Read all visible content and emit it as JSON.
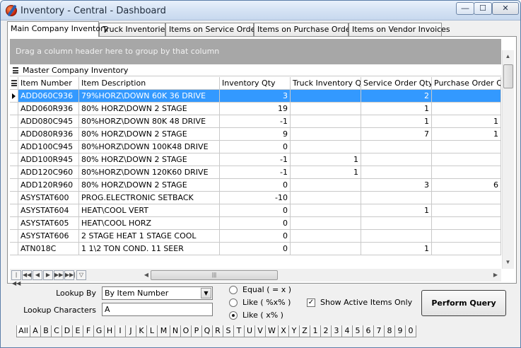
{
  "window": {
    "title": "Inventory - Central - Dashboard",
    "min_label": "—",
    "max_label": "☐",
    "close_label": "✕"
  },
  "tabs": [
    {
      "label": "Main Company Inventory",
      "active": true
    },
    {
      "label": "Truck Inventories",
      "active": false
    },
    {
      "label": "Items on Service Orders",
      "active": false
    },
    {
      "label": "Items on Purchase Orders",
      "active": false
    },
    {
      "label": "Items on Vendor Invoices",
      "active": false
    }
  ],
  "grid": {
    "group_hint": "Drag a column header here to group by that column",
    "band_title": "Master Company Inventory",
    "columns": [
      "Item Number",
      "Item Description",
      "Inventory Qty",
      "Truck Inventory Qty",
      "Service Order Qty",
      "Purchase Order Qty"
    ],
    "rows": [
      [
        "ADD060C936",
        "79%HORZ\\DOWN 60K 36 DRIVE",
        "3",
        "",
        "2",
        ""
      ],
      [
        "ADD060R936",
        "80% HORZ\\DOWN 2 STAGE",
        "19",
        "",
        "1",
        ""
      ],
      [
        "ADD080C945",
        "80%HORZ\\DOWN 80K 48 DRIVE",
        "-1",
        "",
        "1",
        "1"
      ],
      [
        "ADD080R936",
        "80% HORZ\\DOWN 2 STAGE",
        "9",
        "",
        "7",
        "1"
      ],
      [
        "ADD100C945",
        "80%HORZ\\DOWN 100K48 DRIVE",
        "0",
        "",
        "",
        ""
      ],
      [
        "ADD100R945",
        "80% HORZ\\DOWN 2 STAGE",
        "-1",
        "1",
        "",
        ""
      ],
      [
        "ADD120C960",
        "80%HORZ\\DOWN 120K60 DRIVE",
        "-1",
        "1",
        "",
        ""
      ],
      [
        "ADD120R960",
        "80% HORZ\\DOWN 2 STAGE",
        "0",
        "",
        "3",
        "6"
      ],
      [
        "ASYSTAT600",
        "PROG.ELECTRONIC SETBACK",
        "-10",
        "",
        "",
        ""
      ],
      [
        "ASYSTAT604",
        "HEAT\\COOL VERT",
        "0",
        "",
        "1",
        ""
      ],
      [
        "ASYSTAT605",
        "HEAT\\COOL HORZ",
        "0",
        "",
        "",
        ""
      ],
      [
        "ASYSTAT606",
        "2 STAGE HEAT 1 STAGE COOL",
        "0",
        "",
        "",
        ""
      ],
      [
        "ATN018C",
        "1 1\\2 TON COND. 11 SEER",
        "0",
        "",
        "1",
        ""
      ]
    ],
    "selected_row": 0,
    "hscroll_grip": "|||"
  },
  "navigator": {
    "first": "|◀◀",
    "prev_page": "◀◀",
    "prev": "◀",
    "next": "▶",
    "next_page": "▶▶",
    "last": "▶▶|",
    "filter": "▽"
  },
  "lookup": {
    "by_label": "Lookup By",
    "by_value": "By Item Number",
    "chars_label": "Lookup Characters",
    "chars_value": "A",
    "radios": [
      {
        "label": "Equal ( = x )",
        "checked": false
      },
      {
        "label": "Like ( %x% )",
        "checked": false
      },
      {
        "label": "Like ( x% )",
        "checked": true
      }
    ],
    "active_only_label": "Show Active Items Only",
    "active_only_checked": true,
    "query_button": "Perform Query"
  },
  "letters": [
    "All",
    "A",
    "B",
    "C",
    "D",
    "E",
    "F",
    "G",
    "H",
    "I",
    "J",
    "K",
    "L",
    "M",
    "N",
    "O",
    "P",
    "Q",
    "R",
    "S",
    "T",
    "U",
    "V",
    "W",
    "X",
    "Y",
    "Z",
    "1",
    "2",
    "3",
    "4",
    "5",
    "6",
    "7",
    "8",
    "9",
    "0"
  ],
  "active_letter": "All"
}
